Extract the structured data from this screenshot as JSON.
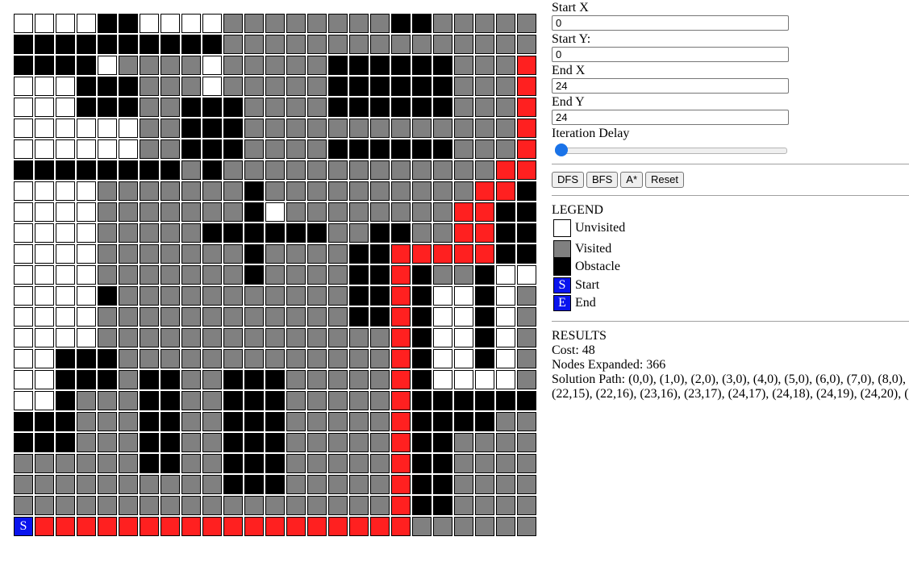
{
  "grid": {
    "rows": 25,
    "cols": 25,
    "cells": [
      "uuuuoouuuuvvvvvvvvoovvvvvE",
      "oooooooooovvvvvvvvvvvvvvvp",
      "oooouvvvvuvvvvvoooooovvvp",
      "uuuooovvvuvvvvvoooooovvvp",
      "uuuooovvooovvvvoooooovvvp",
      "uuuuuuvvooovvvvvvvvvvvvvp",
      "uuuuuuvvooovvvvoooooovvvp",
      "oooooooovovvvvvvvvvvvvvpp",
      "uuuuvvvvvvvovvvvvvvvvvppo",
      "uuuuvvvvvvvouvvvvvvvvppoo",
      "uuuuvvvvvoooooovvoovvppooo",
      "uuuuvvvvvvvovvvvoopppppooo",
      "uuuuvvvvvvvovvvvoopovvouuo",
      "uuuuovvvvvvvvvvvoopouuouvv",
      "uuuuvvvvvvvvvvvvoopouuouvv",
      "uuuuvvvvvvvvvvvvvvpouuouvv",
      "uuooovvvvvvvvvvvvvpouuouvv",
      "uuooovoovvooovvvvvpouuuuvv",
      "uuovvvoovvooovvvvvpoooooov",
      "ooovvvoovvooovvvvvpoooovvv",
      "ooovvvoovvooovvvvvpoovvvvv",
      "vvvvvvoovvooovvvvvpoovvvvv",
      "vvvvvvvvvvooovvvvvpoovvvvv",
      "vvvvvvvvvvvvvvvvvvpoovvvvv",
      "Sppppppppppppppppppvvvvvvv"
    ],
    "start_label": "S",
    "end_label": "E"
  },
  "controls": {
    "start_x_label": "Start X",
    "start_x_value": "0",
    "start_y_label": "Start Y:",
    "start_y_value": "0",
    "end_x_label": "End X",
    "end_x_value": "24",
    "end_y_label": "End Y",
    "end_y_value": "24",
    "delay_label": "Iteration Delay",
    "delay_value": 0
  },
  "buttons": {
    "dfs": "DFS",
    "bfs": "BFS",
    "astar": "A*",
    "reset": "Reset"
  },
  "legend": {
    "title": "LEGEND",
    "unvisited": "Unvisited",
    "visited": "Visited",
    "obstacle": "Obstacle",
    "start_symbol": "S",
    "start": "Start",
    "end_symbol": "E",
    "end": "End"
  },
  "results": {
    "title": "RESULTS",
    "cost": "Cost: 48",
    "nodes_expanded": "Nodes Expanded: 366",
    "path_line1": "Solution Path: (0,0), (1,0), (2,0), (3,0), (4,0), (5,0), (6,0), (7,0), (8,0),",
    "path_line2": "(22,15), (22,16), (23,16), (23,17), (24,17), (24,18), (24,19), (24,20), ("
  },
  "colors": {
    "unvisited": "#ffffff",
    "visited": "#808080",
    "obstacle": "#000000",
    "path": "#ff2020",
    "start_end": "#0a14ee",
    "slider_accent": "#1a73e8"
  }
}
